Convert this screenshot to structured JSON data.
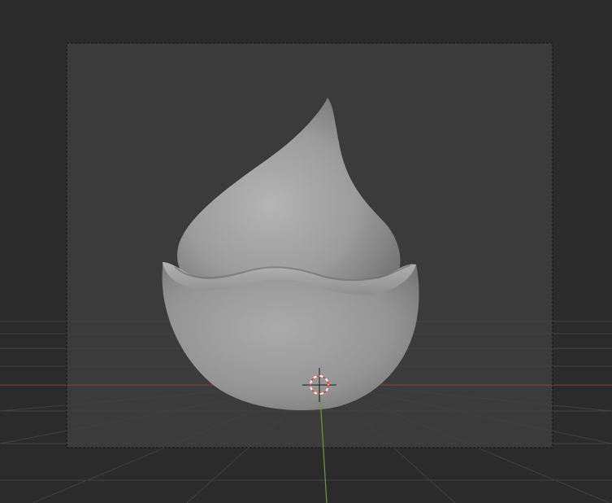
{
  "viewport": {
    "background_color": "#2b2b2b",
    "camera_frame_fill": "#3c3c3c",
    "grid_line_color": "#383838",
    "x_axis_color": "#8b3a3f",
    "y_axis_color": "#6f9a3a",
    "object_color": "#9a9a9a",
    "cursor_color_a": "#e04848",
    "cursor_color_b": "#ffffff"
  },
  "scene": {
    "object": "egg-shell-with-drop-sculpt",
    "icons": {
      "cursor": "3d-cursor-icon"
    }
  }
}
